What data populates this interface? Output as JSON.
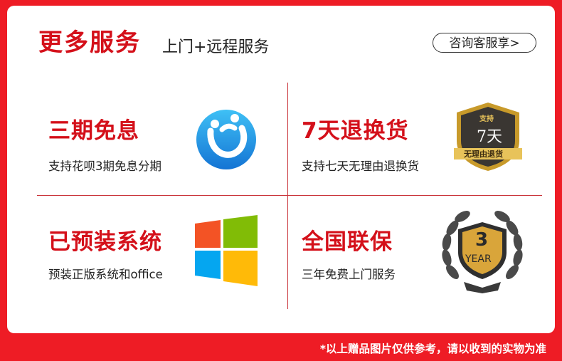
{
  "header": {
    "title": "更多服务",
    "subtitle": "上门+远程服务",
    "consult_button": "咨询客服享>"
  },
  "services": [
    {
      "title": "三期免息",
      "desc": "支持花呗3期免息分期",
      "icon": "huabei-logo-icon"
    },
    {
      "title": "7天退换货",
      "desc": "支持七天无理由退换货",
      "icon": "return-badge-icon",
      "badge_top": "支持",
      "badge_mid": "7天",
      "badge_bottom": "无理由退货"
    },
    {
      "title": "已预装系统",
      "desc": "预装正版系统和office",
      "icon": "windows-logo-icon"
    },
    {
      "title": "全国联保",
      "desc": "三年免费上门服务",
      "icon": "warranty-badge-icon",
      "badge_num": "3",
      "badge_text": "YEAR"
    }
  ],
  "footer": {
    "note": "*以上赠品图片仅供参考，请以收到的实物为准"
  },
  "colors": {
    "brand_red": "#d4101a",
    "background_red": "#ee1c25",
    "huabei_blue": "#1e9ae0",
    "win_red": "#f35325",
    "win_green": "#81bc06",
    "win_blue": "#05a6f0",
    "win_yellow": "#ffba08",
    "gold": "#c89a2a"
  }
}
